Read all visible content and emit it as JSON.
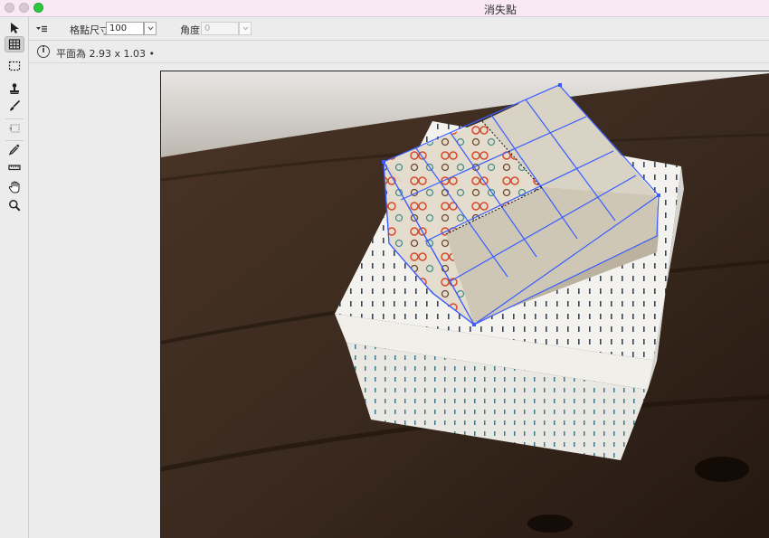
{
  "window": {
    "title": "消失點"
  },
  "toolbar": {
    "tools": [
      {
        "name": "edit-plane-tool",
        "icon": "arrow-pointer-icon"
      },
      {
        "name": "create-plane-tool",
        "icon": "grid-plane-icon",
        "active": true
      },
      {
        "name": "marquee-tool",
        "icon": "dashed-rectangle-icon"
      },
      {
        "name": "stamp-tool",
        "icon": "stamp-icon"
      },
      {
        "name": "brush-tool",
        "icon": "brush-icon"
      },
      {
        "name": "transform-tool",
        "icon": "transform-icon"
      },
      {
        "name": "eyedropper-tool",
        "icon": "eyedropper-icon"
      },
      {
        "name": "measure-tool",
        "icon": "ruler-icon"
      },
      {
        "name": "hand-tool",
        "icon": "hand-icon"
      },
      {
        "name": "zoom-tool",
        "icon": "magnifier-icon"
      }
    ]
  },
  "options": {
    "grid_size_label": "格點尺寸:",
    "grid_size_value": "100",
    "angle_label": "角度:",
    "angle_value": "0"
  },
  "info": {
    "text": "平面為 2.93 x 1.03 •"
  },
  "colors": {
    "titlebar_bg": "#f9e9f5",
    "grid_line": "#3a5cff",
    "maximize_green": "#2bc840"
  }
}
